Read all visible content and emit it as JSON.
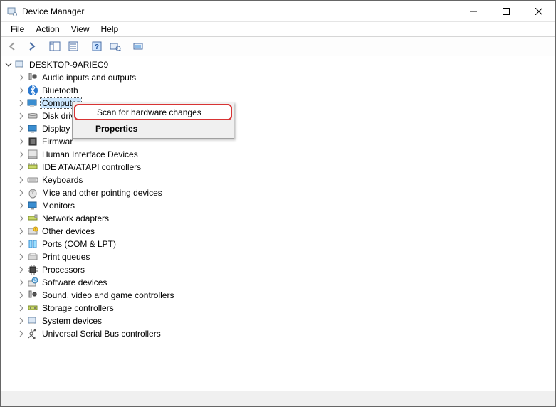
{
  "window": {
    "title": "Device Manager"
  },
  "menubar": {
    "items": [
      "File",
      "Action",
      "View",
      "Help"
    ]
  },
  "tree": {
    "root": {
      "label": "DESKTOP-9ARIEC9"
    },
    "categories": [
      {
        "label": "Audio inputs and outputs"
      },
      {
        "label": "Bluetooth"
      },
      {
        "label": "Computer",
        "selected": true
      },
      {
        "label": "Disk driv"
      },
      {
        "label": "Display a"
      },
      {
        "label": "Firmwar"
      },
      {
        "label": "Human Interface Devices"
      },
      {
        "label": "IDE ATA/ATAPI controllers"
      },
      {
        "label": "Keyboards"
      },
      {
        "label": "Mice and other pointing devices"
      },
      {
        "label": "Monitors"
      },
      {
        "label": "Network adapters"
      },
      {
        "label": "Other devices"
      },
      {
        "label": "Ports (COM & LPT)"
      },
      {
        "label": "Print queues"
      },
      {
        "label": "Processors"
      },
      {
        "label": "Software devices"
      },
      {
        "label": "Sound, video and game controllers"
      },
      {
        "label": "Storage controllers"
      },
      {
        "label": "System devices"
      },
      {
        "label": "Universal Serial Bus controllers"
      }
    ]
  },
  "context_menu": {
    "items": [
      {
        "label": "Scan for hardware changes",
        "highlight": true
      },
      {
        "label": "Properties",
        "bold": true
      }
    ]
  }
}
